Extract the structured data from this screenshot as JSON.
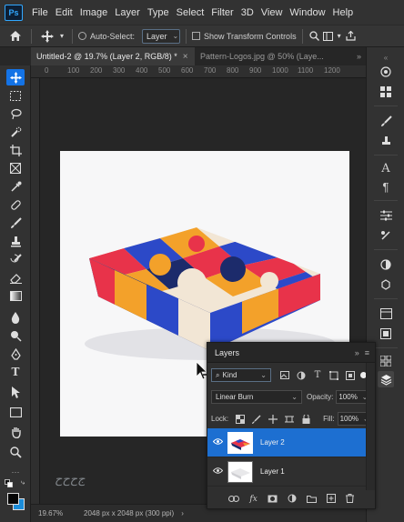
{
  "app": {
    "logo": "Ps"
  },
  "menu": [
    "File",
    "Edit",
    "Image",
    "Layer",
    "Type",
    "Select",
    "Filter",
    "3D",
    "View",
    "Window",
    "Help"
  ],
  "options": {
    "auto_select_label": "Auto-Select:",
    "auto_select_value": "Layer",
    "show_transform_label": "Show Transform Controls"
  },
  "tabs": [
    {
      "label": "Untitled-2 @ 19.7% (Layer 2, RGB/8) *",
      "active": true
    },
    {
      "label": "Pattern-Logos.jpg @ 50% (Laye...",
      "active": false
    }
  ],
  "ruler": [
    "0",
    "100",
    "200",
    "300",
    "400",
    "500",
    "600",
    "700",
    "800",
    "900",
    "1000",
    "1100",
    "1200"
  ],
  "status": {
    "zoom": "19.67%",
    "doc_info": "2048 px x 2048 px (300 ppi)"
  },
  "layers_panel": {
    "title": "Layers",
    "filter_kind": "Kind",
    "blend_mode": "Linear Burn",
    "opacity_label": "Opacity:",
    "opacity_value": "100%",
    "lock_label": "Lock:",
    "fill_label": "Fill:",
    "fill_value": "100%",
    "layers": [
      {
        "name": "Layer 2",
        "selected": true,
        "visible": true
      },
      {
        "name": "Layer 1",
        "selected": false,
        "visible": true
      }
    ]
  },
  "colors": {
    "foreground": "#050505",
    "background": "#1b8cd8",
    "accent": "#1473e6",
    "pattern_red": "#e8334a",
    "pattern_blue": "#2c49c8",
    "pattern_orange": "#f3a12a",
    "pattern_navy": "#1c2b6b",
    "pattern_cream": "#f2e6d5"
  },
  "watermark": "ج‌ح‌ح‌ح"
}
